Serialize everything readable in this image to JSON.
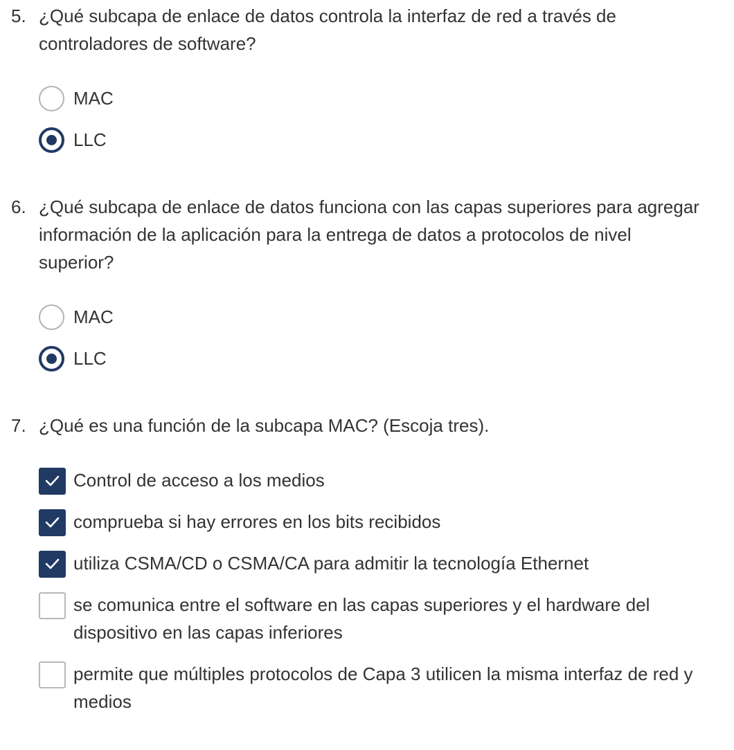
{
  "questions": [
    {
      "number": "5.",
      "text": "¿Qué subcapa de enlace de datos controla la interfaz de red a través de controladores de software?",
      "type": "radio",
      "options": [
        {
          "label": "MAC",
          "selected": false
        },
        {
          "label": "LLC",
          "selected": true
        }
      ]
    },
    {
      "number": "6.",
      "text": "¿Qué subcapa de enlace de datos funciona con las capas superiores para agregar información de la aplicación para la entrega de datos a protocolos de nivel superior?",
      "type": "radio",
      "options": [
        {
          "label": "MAC",
          "selected": false
        },
        {
          "label": "LLC",
          "selected": true
        }
      ]
    },
    {
      "number": "7.",
      "text": "¿Qué es una función de la subcapa MAC? (Escoja tres).",
      "type": "checkbox",
      "options": [
        {
          "label": "Control de acceso a los medios",
          "selected": true
        },
        {
          "label": "comprueba si hay errores en los bits recibidos",
          "selected": true
        },
        {
          "label": "utiliza CSMA/CD o CSMA/CA para admitir la tecnología Ethernet",
          "selected": true
        },
        {
          "label": "se comunica entre el software en las capas superiores y el hardware del dispositivo en las capas inferiores",
          "selected": false
        },
        {
          "label": "permite que múltiples protocolos de Capa 3 utilicen la misma interfaz de red y medios",
          "selected": false
        }
      ]
    }
  ],
  "colors": {
    "accent": "#213a64",
    "text": "#333333",
    "border": "#b3b3b3"
  },
  "icons": {
    "radio_selected": "radio-selected-icon",
    "radio_unselected": "radio-unselected-icon",
    "checkbox_checked": "checkmark-icon",
    "checkbox_unchecked": "checkbox-empty-icon"
  }
}
